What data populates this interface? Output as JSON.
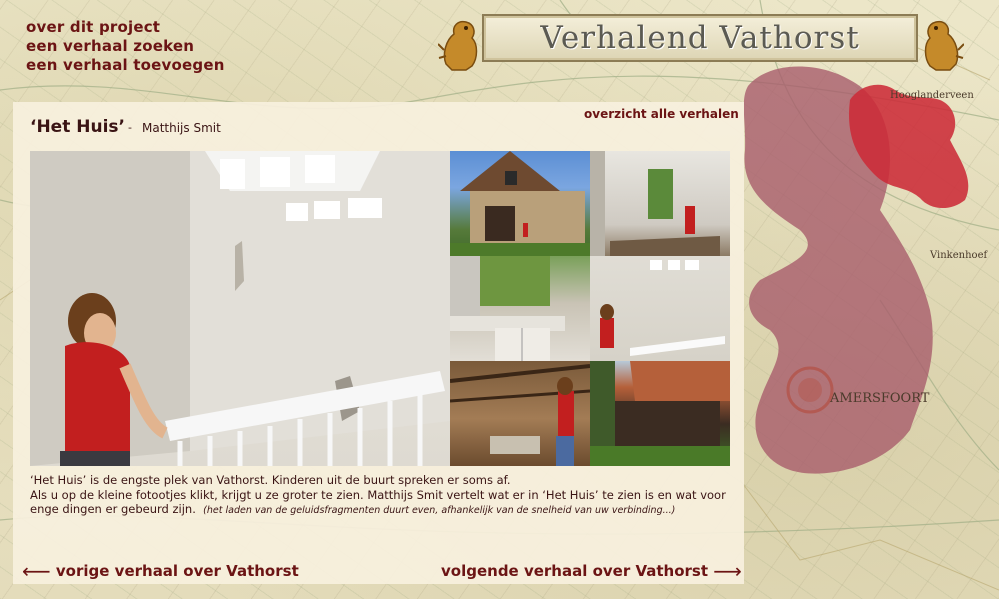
{
  "site": {
    "title": "Verhalend Vathorst"
  },
  "topnav": [
    {
      "label": "over dit project"
    },
    {
      "label": "een verhaal zoeken"
    },
    {
      "label": "een verhaal toevoegen"
    }
  ],
  "story": {
    "title": "‘Het Huis’",
    "separator": "-",
    "author": "Matthijs Smit",
    "overview_link": "overzicht alle verhalen",
    "description_line1": "‘Het Huis’ is de engste plek van Vathorst. Kinderen uit de buurt spreken er soms af.",
    "description_line2": "Als u op de kleine fotootjes klikt, krijgt u ze groter te zien. Matthijs Smit vertelt wat er in ‘Het Huis’ te zien is en wat voor enge dingen er gebeurd zijn.",
    "description_note": "(het laden van de geluidsfragmenten duurt even, afhankelijk van de snelheid van uw verbinding...)"
  },
  "footer": {
    "prev_label": "vorige verhaal over Vathorst",
    "next_label": "volgende verhaal over Vathorst",
    "prev_arrow": "⟵",
    "next_arrow": "⟶"
  },
  "map_labels": {
    "label_a": "Hooglanderveen",
    "label_b": "Vinkenhoef",
    "label_c": "AMERSFOORT"
  },
  "colors": {
    "accent": "#6b1414",
    "highlight": "#cc2b38",
    "area": "#a85c6c"
  }
}
